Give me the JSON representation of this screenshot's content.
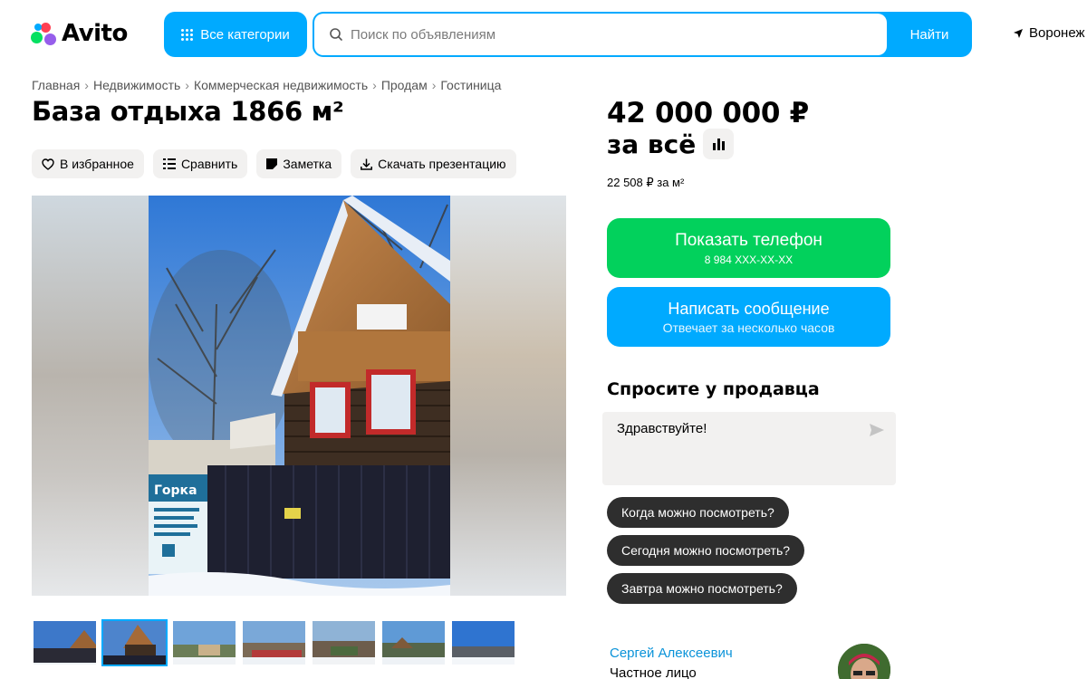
{
  "header": {
    "logo_text": "Avito",
    "categories_label": "Все категории",
    "search_placeholder": "Поиск по объявлениям",
    "search_button": "Найти",
    "location": "Воронеж"
  },
  "breadcrumb": [
    "Главная",
    "Недвижимость",
    "Коммерческая недвижимость",
    "Продам",
    "Гостиница"
  ],
  "title": "База отдыха 1866 м²",
  "actions": {
    "favorite": "В избранное",
    "compare": "Сравнить",
    "note": "Заметка",
    "download": "Скачать презентацию"
  },
  "gallery": {
    "sign_text": "Горка",
    "thumb_count": 7,
    "active_thumb": 1
  },
  "price": {
    "amount": "42 000 000 ₽",
    "label": "за всё",
    "per_m2": "22 508 ₽ за м²"
  },
  "contact": {
    "phone_label": "Показать телефон",
    "phone_masked": "8 984 XXX-XX-XX",
    "message_label": "Написать сообщение",
    "message_sub": "Отвечает за несколько часов"
  },
  "ask": {
    "title": "Спросите у продавца",
    "input_value": "Здравствуйте!",
    "chips": [
      "Когда можно посмотреть?",
      "Сегодня можно посмотреть?",
      "Завтра можно посмотреть?"
    ]
  },
  "seller": {
    "name": "Сергей Алексеевич",
    "type": "Частное лицо"
  },
  "colors": {
    "accent_blue": "#00aaff",
    "green": "#02d15c",
    "chip_dark": "#2e2e2e",
    "seller_link": "#0a93d9"
  }
}
